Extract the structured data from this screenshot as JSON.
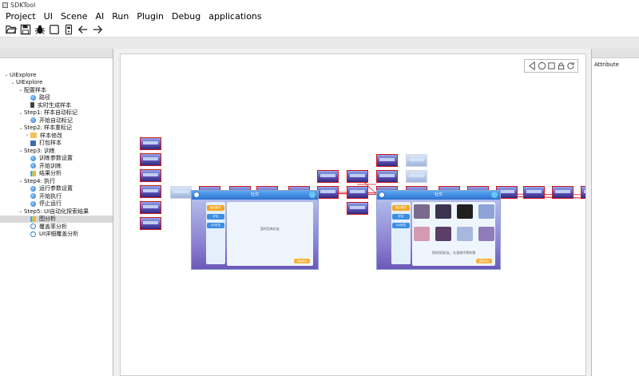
{
  "window": {
    "title": "SDKTool"
  },
  "menu": [
    "Project",
    "UI",
    "Scene",
    "AI",
    "Run",
    "Plugin",
    "Debug",
    "applications"
  ],
  "toolbar": {
    "open_icon": "folder-open-icon",
    "save_icon": "save-icon",
    "bug_icon": "bug-icon",
    "square_icon": "square-icon",
    "device_icon": "device-icon",
    "back_icon": "arrow-left-icon",
    "forward_icon": "arrow-right-icon"
  },
  "tree": {
    "root": "UIExplore",
    "child": "UIExplore",
    "groups": [
      {
        "label": "配置样本",
        "items": [
          {
            "label": "路径",
            "icon": "blue"
          },
          {
            "label": "实时生成样本",
            "icon": "phone"
          }
        ]
      },
      {
        "label": "Step1: 样本自动标记",
        "items": [
          {
            "label": "开始自动标记",
            "icon": "blue"
          }
        ]
      },
      {
        "label": "Step2: 样本重标记",
        "items": [
          {
            "label": "样本修改",
            "icon": "folder"
          },
          {
            "label": "打包样本",
            "icon": "save"
          }
        ]
      },
      {
        "label": "Step3: 训练",
        "items": [
          {
            "label": "训练参数设置",
            "icon": "blue"
          },
          {
            "label": "开始训练",
            "icon": "blue"
          },
          {
            "label": "结果分析",
            "icon": "chart"
          }
        ]
      },
      {
        "label": "Step4: 执行",
        "items": [
          {
            "label": "运行参数设置",
            "icon": "blue"
          },
          {
            "label": "开始执行",
            "icon": "blue"
          },
          {
            "label": "停止运行",
            "icon": "blue"
          }
        ]
      },
      {
        "label": "Step5: UI自动化探索结果",
        "items": [
          {
            "label": "图分析",
            "icon": "chart"
          },
          {
            "label": "覆盖率分析",
            "icon": "refresh"
          },
          {
            "label": "UI详细覆盖分析",
            "icon": "refresh"
          }
        ]
      }
    ]
  },
  "attribute": {
    "title": "Attribute"
  },
  "graph": {
    "screen_left": {
      "title": "社交",
      "tabs": [
        "最近聊天",
        "好友",
        "QQ好友"
      ],
      "message": "暂时没有好友",
      "button": "添加好友"
    },
    "screen_right": {
      "title": "社交",
      "tabs": [
        "最近聊天",
        "好友",
        "QQ好友"
      ],
      "message": "您的QQ好友，在游戏中等你哦",
      "button": "邀请好友"
    }
  }
}
